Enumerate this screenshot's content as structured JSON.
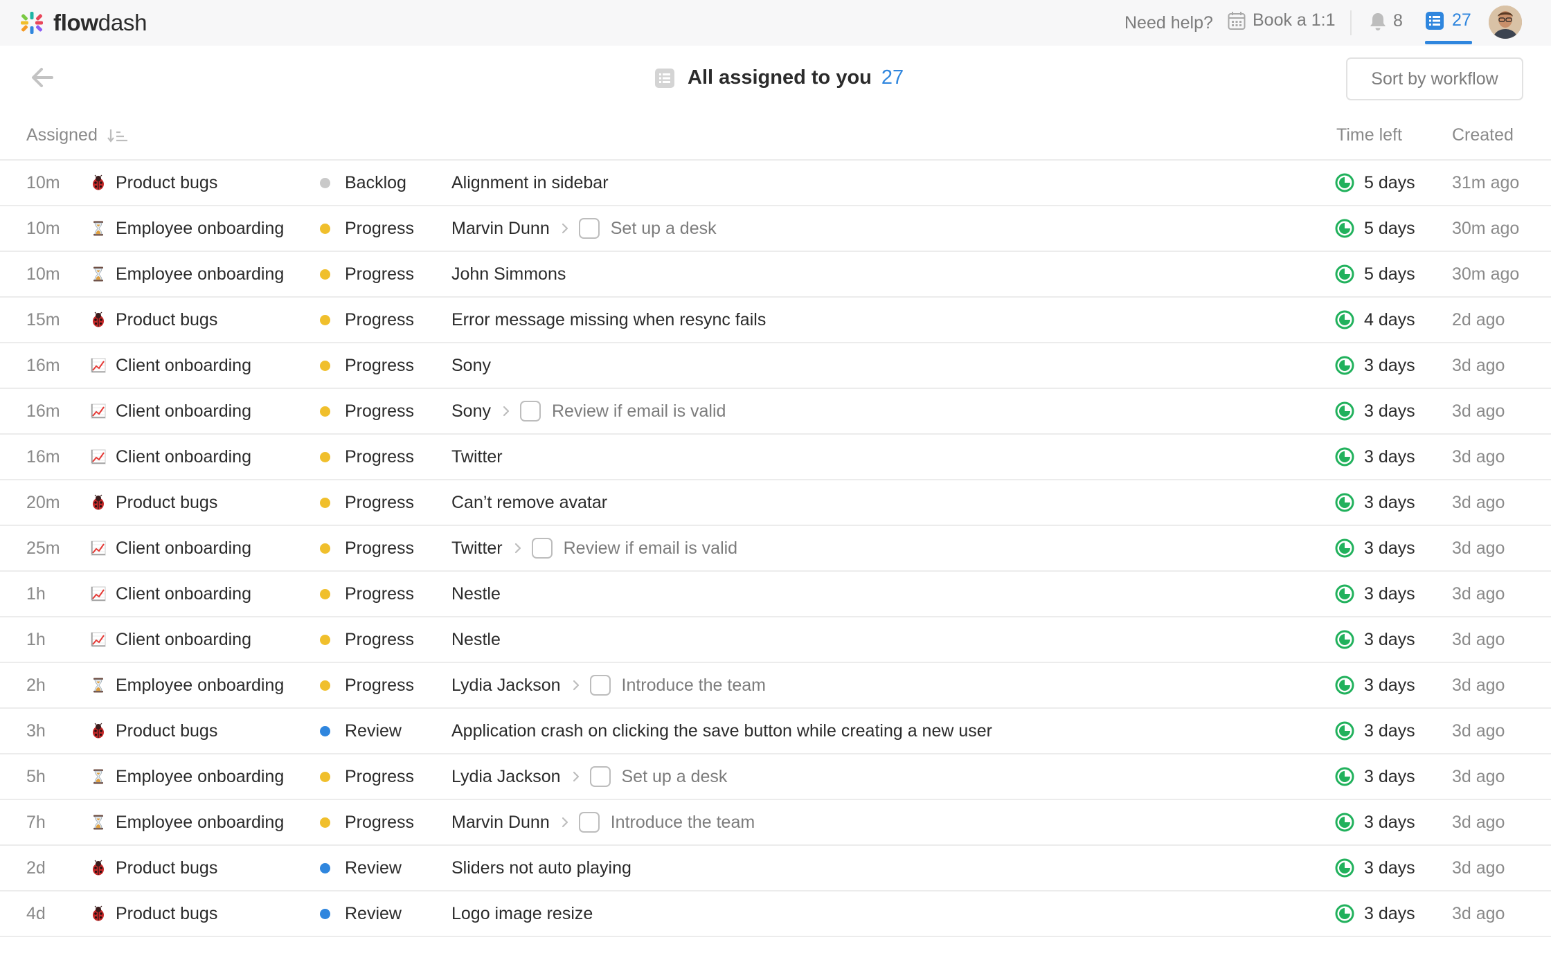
{
  "app": {
    "name_bold": "flow",
    "name_rest": "dash"
  },
  "topbar": {
    "help_label": "Need help?",
    "book_label": "Book a 1:1",
    "notifications_count": "8",
    "tasks_count": "27",
    "accent_color": "#2f86de"
  },
  "header": {
    "title": "All assigned to you",
    "count": "27",
    "sort_label": "Sort by workflow"
  },
  "columns": {
    "assigned": "Assigned",
    "time_left": "Time left",
    "created": "Created"
  },
  "stage_colors": {
    "Backlog": "#c9c9c9",
    "Progress": "#f0bf2c",
    "Review": "#2f86de"
  },
  "workflow_icons": {
    "Product bugs": "ladybug-icon",
    "Employee onboarding": "hourglass-icon",
    "Client onboarding": "chart-increasing-icon"
  },
  "rows": [
    {
      "assigned": "10m",
      "workflow": "Product bugs",
      "stage": "Backlog",
      "task": "Alignment in sidebar",
      "subtask": "",
      "time_left": "5 days",
      "created": "31m ago"
    },
    {
      "assigned": "10m",
      "workflow": "Employee onboarding",
      "stage": "Progress",
      "task": "Marvin Dunn",
      "subtask": "Set up a desk",
      "time_left": "5 days",
      "created": "30m ago"
    },
    {
      "assigned": "10m",
      "workflow": "Employee onboarding",
      "stage": "Progress",
      "task": "John Simmons",
      "subtask": "",
      "time_left": "5 days",
      "created": "30m ago"
    },
    {
      "assigned": "15m",
      "workflow": "Product bugs",
      "stage": "Progress",
      "task": "Error message missing when resync fails",
      "subtask": "",
      "time_left": "4 days",
      "created": "2d ago"
    },
    {
      "assigned": "16m",
      "workflow": "Client onboarding",
      "stage": "Progress",
      "task": "Sony",
      "subtask": "",
      "time_left": "3 days",
      "created": "3d ago"
    },
    {
      "assigned": "16m",
      "workflow": "Client onboarding",
      "stage": "Progress",
      "task": "Sony",
      "subtask": "Review if email is valid",
      "time_left": "3 days",
      "created": "3d ago"
    },
    {
      "assigned": "16m",
      "workflow": "Client onboarding",
      "stage": "Progress",
      "task": "Twitter",
      "subtask": "",
      "time_left": "3 days",
      "created": "3d ago"
    },
    {
      "assigned": "20m",
      "workflow": "Product bugs",
      "stage": "Progress",
      "task": "Can’t remove avatar",
      "subtask": "",
      "time_left": "3 days",
      "created": "3d ago"
    },
    {
      "assigned": "25m",
      "workflow": "Client onboarding",
      "stage": "Progress",
      "task": "Twitter",
      "subtask": "Review if email is valid",
      "time_left": "3 days",
      "created": "3d ago"
    },
    {
      "assigned": "1h",
      "workflow": "Client onboarding",
      "stage": "Progress",
      "task": "Nestle",
      "subtask": "",
      "time_left": "3 days",
      "created": "3d ago"
    },
    {
      "assigned": "1h",
      "workflow": "Client onboarding",
      "stage": "Progress",
      "task": "Nestle",
      "subtask": "",
      "time_left": "3 days",
      "created": "3d ago"
    },
    {
      "assigned": "2h",
      "workflow": "Employee onboarding",
      "stage": "Progress",
      "task": "Lydia Jackson",
      "subtask": "Introduce the team",
      "time_left": "3 days",
      "created": "3d ago"
    },
    {
      "assigned": "3h",
      "workflow": "Product bugs",
      "stage": "Review",
      "task": "Application crash on clicking the save button while creating a new user",
      "subtask": "",
      "time_left": "3 days",
      "created": "3d ago"
    },
    {
      "assigned": "5h",
      "workflow": "Employee onboarding",
      "stage": "Progress",
      "task": "Lydia Jackson",
      "subtask": "Set up a desk",
      "time_left": "3 days",
      "created": "3d ago"
    },
    {
      "assigned": "7h",
      "workflow": "Employee onboarding",
      "stage": "Progress",
      "task": "Marvin Dunn",
      "subtask": "Introduce the team",
      "time_left": "3 days",
      "created": "3d ago"
    },
    {
      "assigned": "2d",
      "workflow": "Product bugs",
      "stage": "Review",
      "task": "Sliders not auto playing",
      "subtask": "",
      "time_left": "3 days",
      "created": "3d ago"
    },
    {
      "assigned": "4d",
      "workflow": "Product bugs",
      "stage": "Review",
      "task": "Logo image resize",
      "subtask": "",
      "time_left": "3 days",
      "created": "3d ago"
    }
  ]
}
